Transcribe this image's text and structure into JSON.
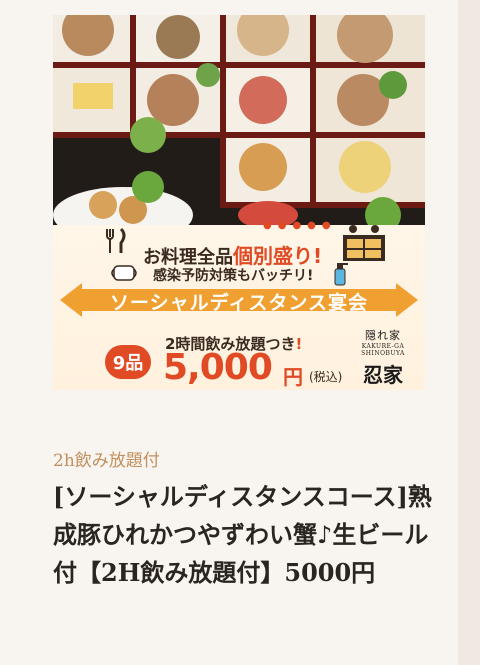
{
  "banner": {
    "headline_prefix": "お料理全品",
    "headline_highlight": "個別盛り!",
    "subheadline": "感染予防対策もバッチリ!",
    "arrow_text": "ソーシャルディスタンス宴会",
    "badge": "9品",
    "nomihodai_prefix": "2時間飲み放題つき",
    "nomihodai_mark": "!",
    "price": "5,000",
    "price_unit": "円",
    "tax_note": "(税込)",
    "logo": {
      "line1": "隠れ家",
      "line2": "KAKURE-GA SHINOBUYA",
      "line3": "忍家"
    },
    "colors": {
      "accent": "#e04a25",
      "arrow": "#f0a030"
    }
  },
  "product": {
    "category": "2h飲み放題付",
    "title": "[ソーシャルディスタンスコース]熟成豚ひれかつやずわい蟹♪生ビール付【2H飲み放題付】5000円"
  }
}
